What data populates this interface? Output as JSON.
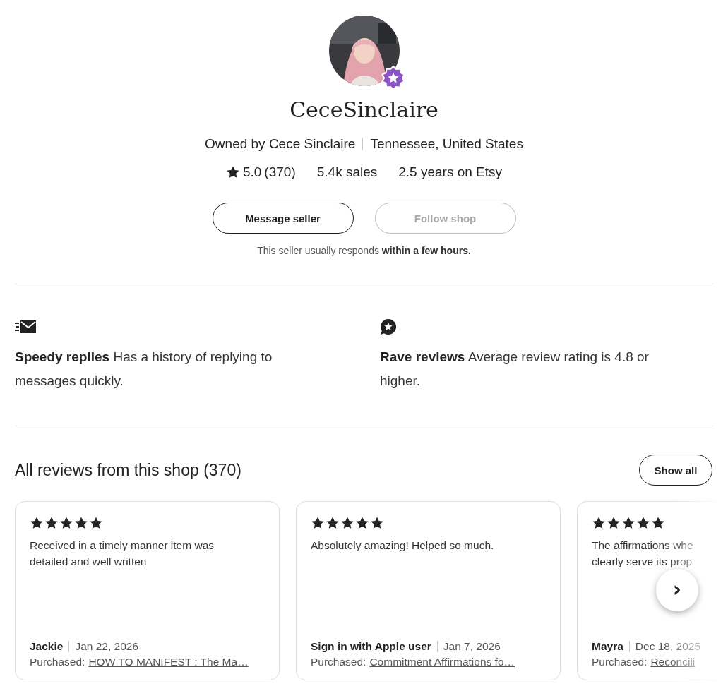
{
  "shop": {
    "name": "CeceSinclaire",
    "owner": "Owned by Cece Sinclaire",
    "location": "Tennessee, United States",
    "rating": "5.0",
    "rating_count": "(370)",
    "sales": "5.4k sales",
    "tenure": "2.5 years on Etsy",
    "buttons": [
      {
        "label": "Message seller",
        "disabled": false
      },
      {
        "label": "Follow shop",
        "disabled": true
      }
    ],
    "response_note": "This seller usually responds **within a few hours.**"
  },
  "highlights": [
    {
      "kind": "speedy",
      "text": "**Speedy replies** Has a history of replying to messages quickly."
    },
    {
      "kind": "rave",
      "text": "**Rave reviews** Average review rating is 4.8 or higher."
    }
  ],
  "reviews": {
    "title": "All reviews from this shop (370)",
    "show_all": "Show all",
    "next": "›",
    "items": [
      {
        "stars": 5,
        "text": "Received in a timely manner item was detailed and well written",
        "author": "Jackie",
        "date": "Jan 22, 2026",
        "purchased_label": "Purchased:",
        "item": "HOW TO MANIFEST : The Ma…"
      },
      {
        "stars": 5,
        "text": "Absolutely amazing! Helped so much.",
        "author": "Sign in with Apple user",
        "date": "Jan 7, 2026",
        "purchased_label": "Purchased:",
        "item": "Commitment Affirmations fo…"
      },
      {
        "stars": 5,
        "text": "The affirmations whe clearly serve its prop",
        "author": "Mayra",
        "date": "Dec 18, 2025",
        "purchased_label": "Purchased:",
        "item": "Reconcili"
      }
    ]
  }
}
